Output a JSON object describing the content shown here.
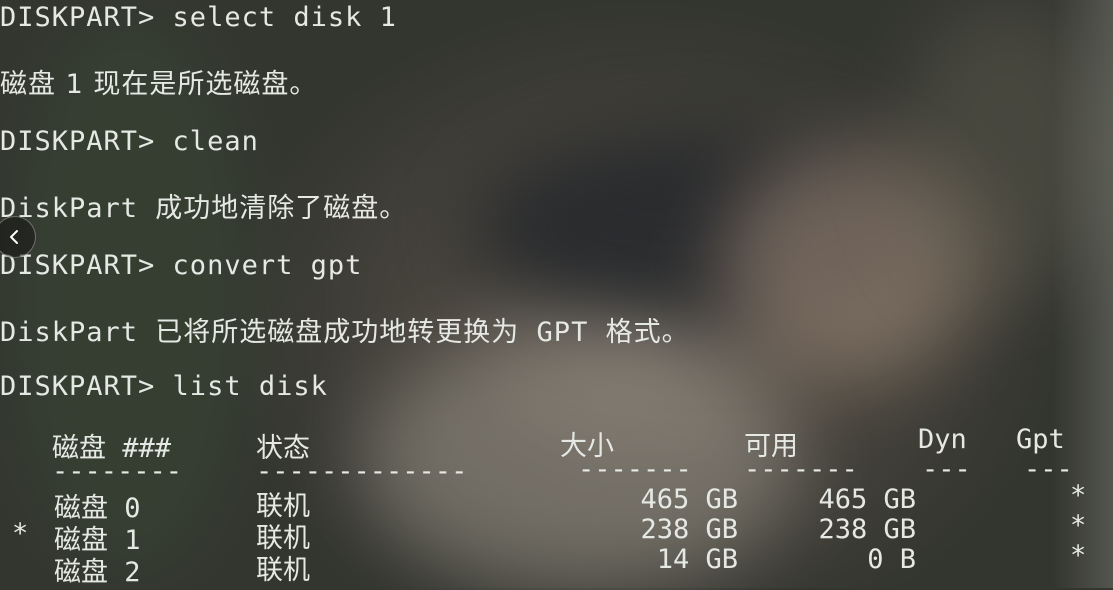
{
  "terminal": {
    "lines": [
      "DISKPART> select disk 1",
      "磁盘 1 现在是所选磁盘。",
      "DISKPART> clean",
      "DiskPart 成功地清除了磁盘。",
      "DISKPART> convert gpt",
      "DiskPart 已将所选磁盘成功地转更换为 GPT 格式。",
      "DISKPART> list disk"
    ]
  },
  "table": {
    "headers": [
      "磁盘 ###",
      "状态",
      "大小",
      "可用",
      "Dyn",
      "Gpt"
    ],
    "separators": [
      "--------",
      "-------------",
      "-------",
      "-------",
      "---",
      "---"
    ],
    "rows": [
      {
        "marker": "",
        "disk": "磁盘 0",
        "status": "联机",
        "size": "465 GB",
        "free": "465 GB",
        "dyn": "",
        "gpt": "*"
      },
      {
        "marker": "*",
        "disk": "磁盘 1",
        "status": "联机",
        "size": "238 GB",
        "free": "238 GB",
        "dyn": "",
        "gpt": "*"
      },
      {
        "marker": "",
        "disk": "磁盘 2",
        "status": "联机",
        "size": "14 GB",
        "free": "0 B",
        "dyn": "",
        "gpt": "*"
      }
    ]
  },
  "icons": {
    "nav_left": "chevron-left-icon"
  },
  "colors": {
    "text": "#e6e8e4",
    "background": "#3a3b34"
  }
}
